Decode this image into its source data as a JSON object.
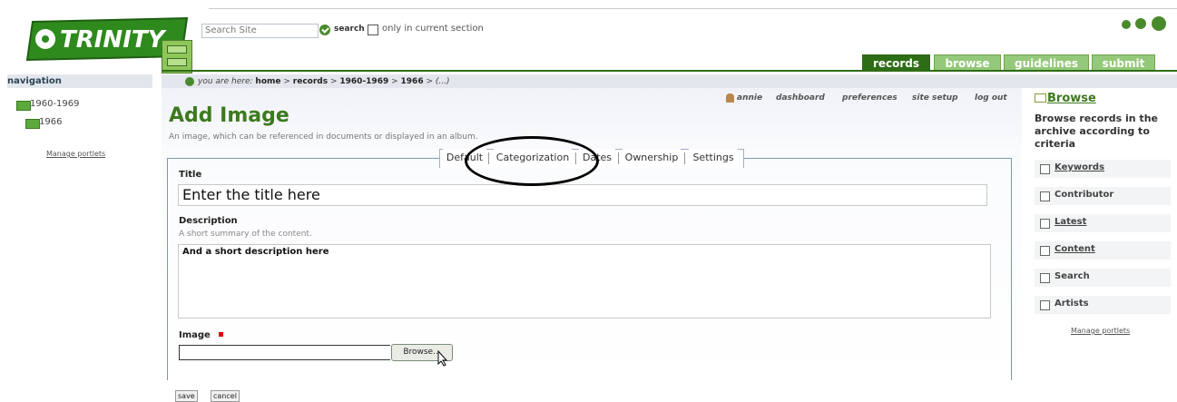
{
  "brand": {
    "logo_text": "TRINITY"
  },
  "search": {
    "placeholder": "Search Site",
    "button_label": "search",
    "only_current_label": "only in current section"
  },
  "tabs": [
    {
      "label": "records",
      "active": true
    },
    {
      "label": "browse",
      "active": false
    },
    {
      "label": "guidelines",
      "active": false
    },
    {
      "label": "submit",
      "active": false
    }
  ],
  "breadcrumb": {
    "prefix": "you are here:",
    "items": [
      "home",
      "records",
      "1960-1969",
      "1966",
      "(...)"
    ],
    "separator": ">"
  },
  "navigation": {
    "heading": "navigation",
    "items": [
      {
        "label": "1960-1969",
        "level": 0
      },
      {
        "label": "1966",
        "level": 1
      }
    ],
    "manage_portlets": "Manage portlets"
  },
  "personal_bar": {
    "user": "annie",
    "links": [
      "dashboard",
      "preferences",
      "site setup",
      "log out"
    ]
  },
  "content": {
    "title": "Add Image",
    "description": "An image, which can be referenced in documents or displayed in an album.",
    "form_tabs": [
      {
        "label": "Default",
        "active": true
      },
      {
        "label": "Categorization",
        "active": false
      },
      {
        "label": "Dates",
        "active": false
      },
      {
        "label": "Ownership",
        "active": false
      },
      {
        "label": "Settings",
        "active": false
      }
    ],
    "fields": {
      "title_label": "Title",
      "title_value": "Enter the title here",
      "description_label": "Description",
      "description_help": "A short summary of the content.",
      "description_value": "And a short description here",
      "image_label": "Image",
      "image_required": true,
      "browse_button": "Browse..."
    },
    "actions": {
      "save": "save",
      "cancel": "cancel"
    }
  },
  "right_portlet": {
    "title": "Browse",
    "description": "Browse records in the archive according to criteria",
    "items": [
      {
        "label": "Keywords",
        "underlined": true
      },
      {
        "label": "Contributor",
        "underlined": false
      },
      {
        "label": "Latest",
        "underlined": true
      },
      {
        "label": "Content",
        "underlined": true
      },
      {
        "label": "Search",
        "underlined": false
      },
      {
        "label": "Artists",
        "underlined": false
      }
    ],
    "manage_portlets": "Manage portlets"
  },
  "colors": {
    "brand_green": "#3d7a1e",
    "tab_active": "#2e6d16",
    "tab_inactive": "#94c87a",
    "breadcrumb_bg": "#e3e6ec",
    "required_marker": "#dd0000"
  },
  "icons": [
    "logo-icon",
    "filing-cabinet-icon",
    "search-go-icon",
    "text-size-icons",
    "folder-icon",
    "user-icon",
    "browse-folder-icon",
    "portlet-link-icon",
    "mouse-cursor-icon"
  ],
  "annotation": {
    "note": "hand-drawn circle around Categorization / Dates tabs"
  }
}
